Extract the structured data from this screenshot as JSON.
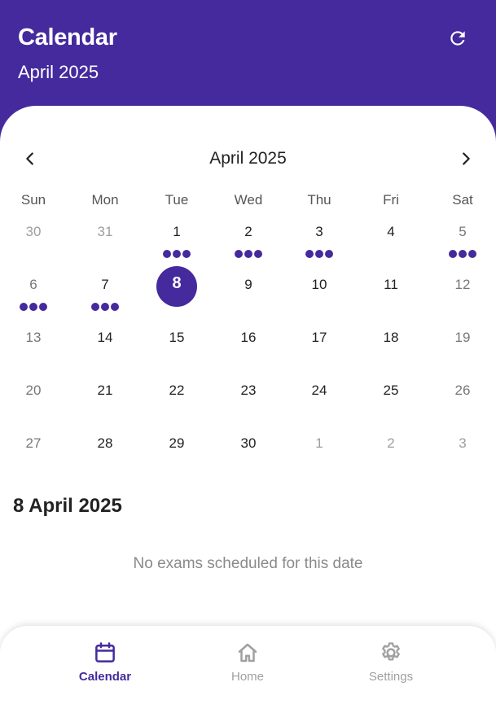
{
  "header": {
    "title": "Calendar",
    "subtitle": "April 2025",
    "refresh_icon": "refresh-icon"
  },
  "calendar": {
    "month_title": "April 2025",
    "prev_icon": "chevron-left-icon",
    "next_icon": "chevron-right-icon",
    "weekdays": [
      "Sun",
      "Mon",
      "Tue",
      "Wed",
      "Thu",
      "Fri",
      "Sat"
    ],
    "accent_color": "#452a9e",
    "weeks": [
      [
        {
          "day": "30",
          "muted": true,
          "dots": 0
        },
        {
          "day": "31",
          "muted": true,
          "dots": 0
        },
        {
          "day": "1",
          "muted": false,
          "dots": 3
        },
        {
          "day": "2",
          "muted": false,
          "dots": 3
        },
        {
          "day": "3",
          "muted": false,
          "dots": 3
        },
        {
          "day": "4",
          "muted": false,
          "dots": 0
        },
        {
          "day": "5",
          "muted": false,
          "dots": 3
        }
      ],
      [
        {
          "day": "6",
          "muted": false,
          "dots": 3
        },
        {
          "day": "7",
          "muted": false,
          "dots": 3
        },
        {
          "day": "8",
          "muted": false,
          "dots": 0,
          "selected": true
        },
        {
          "day": "9",
          "muted": false,
          "dots": 0
        },
        {
          "day": "10",
          "muted": false,
          "dots": 0
        },
        {
          "day": "11",
          "muted": false,
          "dots": 0
        },
        {
          "day": "12",
          "muted": false,
          "dots": 0
        }
      ],
      [
        {
          "day": "13",
          "muted": false,
          "dots": 0
        },
        {
          "day": "14",
          "muted": false,
          "dots": 0
        },
        {
          "day": "15",
          "muted": false,
          "dots": 0
        },
        {
          "day": "16",
          "muted": false,
          "dots": 0
        },
        {
          "day": "17",
          "muted": false,
          "dots": 0
        },
        {
          "day": "18",
          "muted": false,
          "dots": 0
        },
        {
          "day": "19",
          "muted": false,
          "dots": 0
        }
      ],
      [
        {
          "day": "20",
          "muted": false,
          "dots": 0
        },
        {
          "day": "21",
          "muted": false,
          "dots": 0
        },
        {
          "day": "22",
          "muted": false,
          "dots": 0
        },
        {
          "day": "23",
          "muted": false,
          "dots": 0
        },
        {
          "day": "24",
          "muted": false,
          "dots": 0
        },
        {
          "day": "25",
          "muted": false,
          "dots": 0
        },
        {
          "day": "26",
          "muted": false,
          "dots": 0
        }
      ],
      [
        {
          "day": "27",
          "muted": false,
          "dots": 0
        },
        {
          "day": "28",
          "muted": false,
          "dots": 0
        },
        {
          "day": "29",
          "muted": false,
          "dots": 0
        },
        {
          "day": "30",
          "muted": false,
          "dots": 0
        },
        {
          "day": "1",
          "muted": true,
          "dots": 0
        },
        {
          "day": "2",
          "muted": true,
          "dots": 0
        },
        {
          "day": "3",
          "muted": true,
          "dots": 0
        }
      ]
    ]
  },
  "selected_day": {
    "date_label": "8 April 2025",
    "empty_message": "No exams scheduled for this date"
  },
  "bottom_nav": {
    "items": [
      {
        "label": "Calendar",
        "icon": "calendar-icon",
        "active": true
      },
      {
        "label": "Home",
        "icon": "home-icon",
        "active": false
      },
      {
        "label": "Settings",
        "icon": "gear-icon",
        "active": false
      }
    ]
  }
}
